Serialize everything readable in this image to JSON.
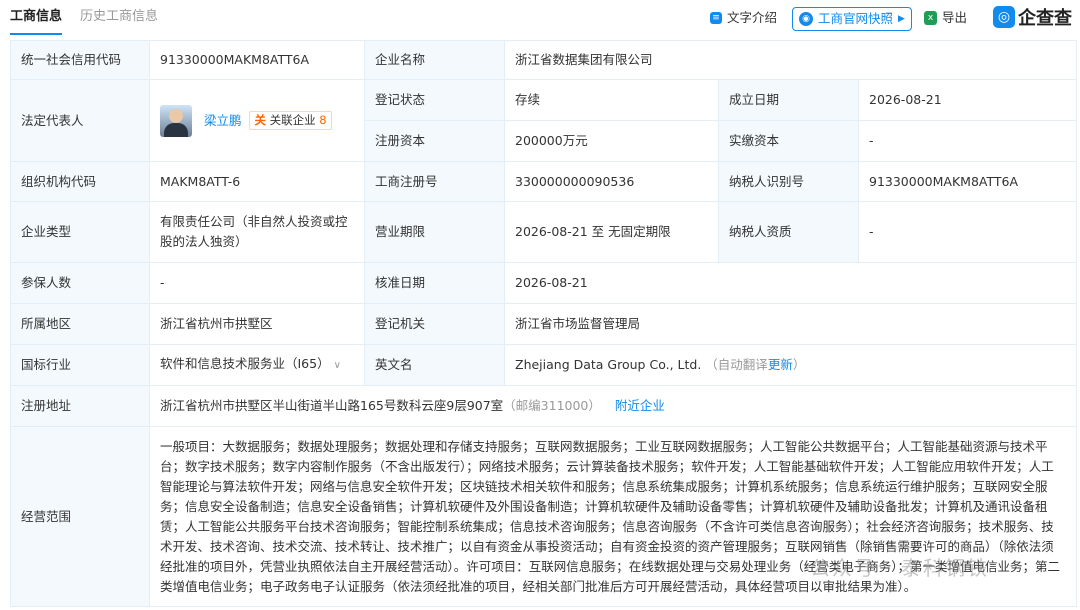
{
  "tabs": {
    "active": "工商信息",
    "inactive": "历史工商信息"
  },
  "toolbar": {
    "text_intro": "文字介绍",
    "snapshot": "工商官网快照",
    "export": "导出",
    "logo": "企查查"
  },
  "rows": {
    "credit_code_label": "统一社会信用代码",
    "credit_code": "91330000MAKM8ATT6A",
    "name_label": "企业名称",
    "name": "浙江省数据集团有限公司",
    "legal_label": "法定代表人",
    "legal_name": "梁立鹏",
    "related_label": "关联企业",
    "related_count": "8",
    "reg_status_label": "登记状态",
    "reg_status": "存续",
    "found_date_label": "成立日期",
    "found_date": "2026-08-21",
    "reg_capital_label": "注册资本",
    "reg_capital": "200000万元",
    "paid_capital_label": "实缴资本",
    "paid_capital": "-",
    "org_code_label": "组织机构代码",
    "org_code": "MAKM8ATT-6",
    "biz_reg_label": "工商注册号",
    "biz_reg": "330000000090536",
    "taxpayer_id_label": "纳税人识别号",
    "taxpayer_id": "91330000MAKM8ATT6A",
    "type_label": "企业类型",
    "type": "有限责任公司（非自然人投资或控股的法人独资）",
    "term_label": "营业期限",
    "term": "2026-08-21 至 无固定期限",
    "taxpayer_q_label": "纳税人资质",
    "taxpayer_q": "-",
    "insured_label": "参保人数",
    "insured": "-",
    "approve_label": "核准日期",
    "approve": "2026-08-21",
    "region_label": "所属地区",
    "region": "浙江省杭州市拱墅区",
    "authority_label": "登记机关",
    "authority": "浙江省市场监督管理局",
    "industry_label": "国标行业",
    "industry": "软件和信息技术服务业（I65）",
    "en_label": "英文名",
    "en": "Zhejiang Data Group Co., Ltd.",
    "en_note": "（自动翻译",
    "en_update": "更新",
    "en_close": "）",
    "addr_label": "注册地址",
    "addr": "浙江省杭州市拱墅区半山街道半山路165号数科云座9层907室",
    "postcode": "（邮编311000）",
    "nearby": "附近企业",
    "scope_label": "经营范围",
    "scope": "一般项目：大数据服务；数据处理服务；数据处理和存储支持服务；互联网数据服务；工业互联网数据服务；人工智能公共数据平台；人工智能基础资源与技术平台；数字技术服务；数字内容制作服务（不含出版发行）；网络技术服务；云计算装备技术服务；软件开发；人工智能基础软件开发；人工智能应用软件开发；人工智能理论与算法软件开发；网络与信息安全软件开发；区块链技术相关软件和服务；信息系统集成服务；计算机系统服务；信息系统运行维护服务；互联网安全服务；信息安全设备制造；信息安全设备销售；计算机软硬件及外围设备制造；计算机软硬件及辅助设备零售；计算机软硬件及辅助设备批发；计算机及通讯设备租赁；人工智能公共服务平台技术咨询服务；智能控制系统集成；信息技术咨询服务；信息咨询服务（不含许可类信息咨询服务）；社会经济咨询服务；技术服务、技术开发、技术咨询、技术交流、技术转让、技术推广；以自有资金从事投资活动；自有资金投资的资产管理服务；互联网销售（除销售需要许可的商品）（除依法须经批准的项目外，凭营业执照依法自主开展经营活动）。许可项目：互联网信息服务；在线数据处理与交易处理业务（经营类电子商务）；第一类增值电信业务；第二类增值电信业务；电子政务电子认证服务（依法须经批准的项目，经相关部门批准后方可开展经营活动，具体经营项目以审批结果为准）。"
  },
  "watermark": "公众号 · 泰科钢铁"
}
